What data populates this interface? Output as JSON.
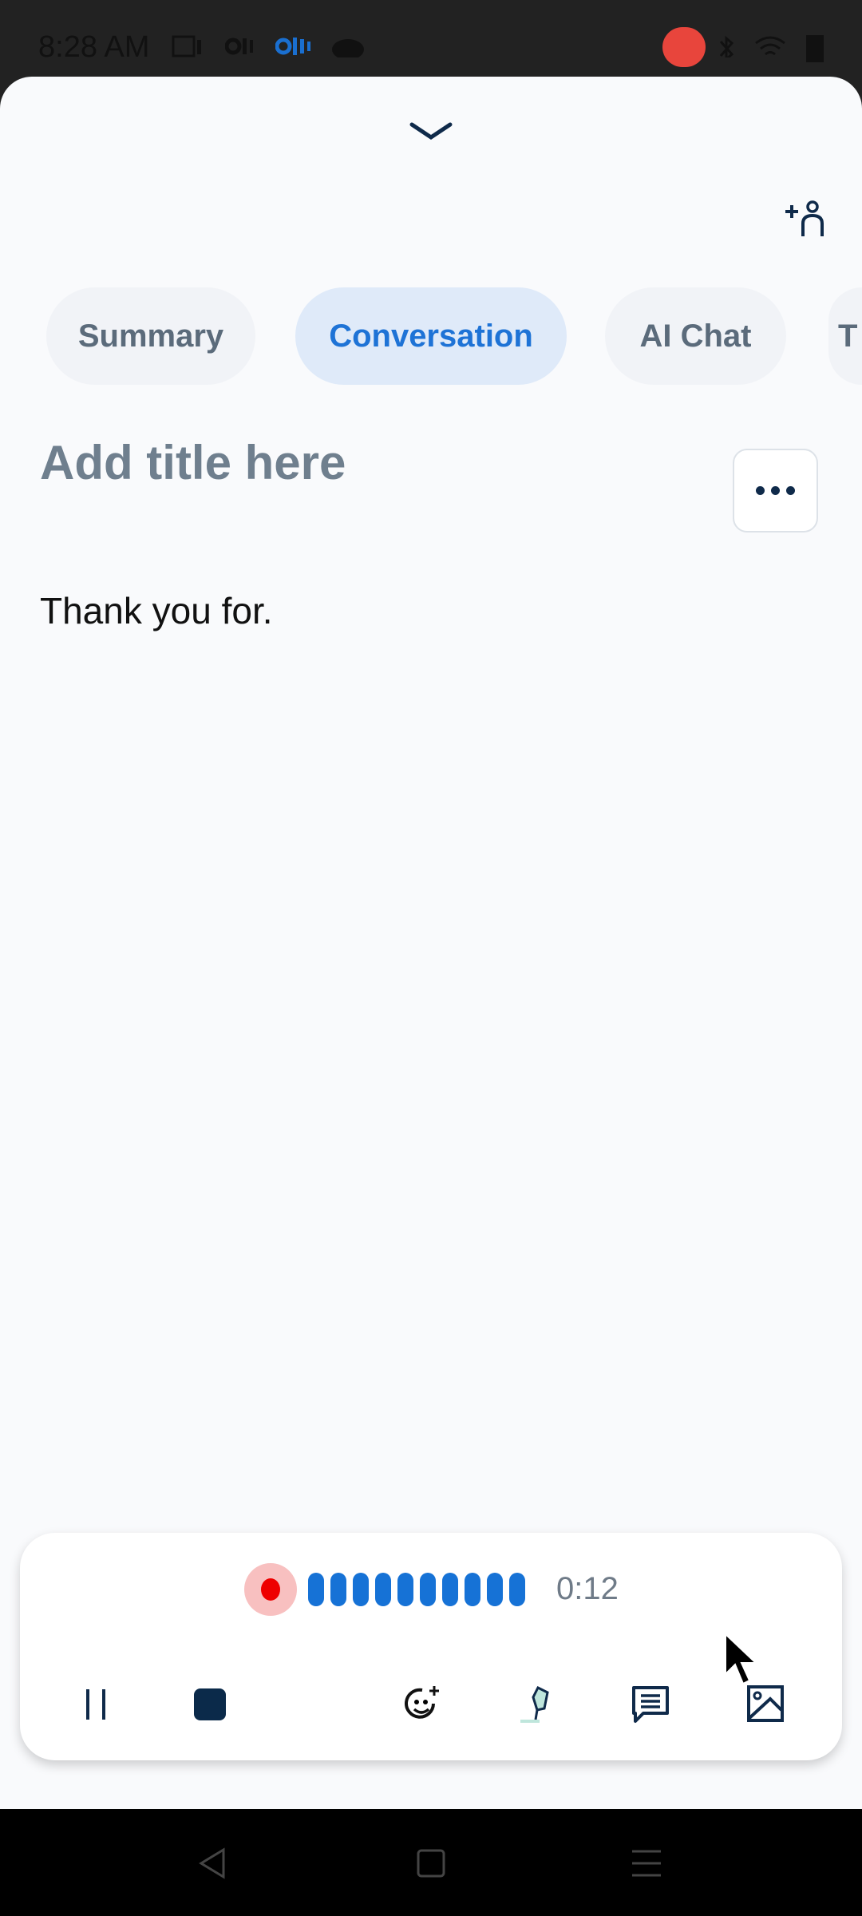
{
  "status_bar": {
    "time": "8:28 AM",
    "icons": [
      "screen-icon",
      "otter-icon",
      "otter-blue-icon",
      "cloud-upload-icon",
      "screen-record-icon",
      "bluetooth-icon",
      "wifi-icon",
      "battery-icon"
    ]
  },
  "header": {
    "collapse_icon": "chevron-down-icon",
    "add_person_icon": "add-person-icon"
  },
  "tabs": [
    {
      "label": "Summary"
    },
    {
      "label": "Conversation",
      "active": true
    },
    {
      "label": "AI Chat"
    },
    {
      "label": "T"
    }
  ],
  "note": {
    "title_placeholder": "Add title here",
    "transcript": "Thank you for."
  },
  "recorder": {
    "timer": "0:12",
    "level_bars": 10,
    "colors": {
      "accent": "#1672d6",
      "record": "#ee0000"
    }
  },
  "toolbar": [
    "pause-icon",
    "stop-icon",
    "add-emoji-icon",
    "highlighter-icon",
    "comment-icon",
    "image-icon"
  ],
  "nav_bar": [
    "back-icon",
    "home-icon",
    "menu-icon"
  ]
}
